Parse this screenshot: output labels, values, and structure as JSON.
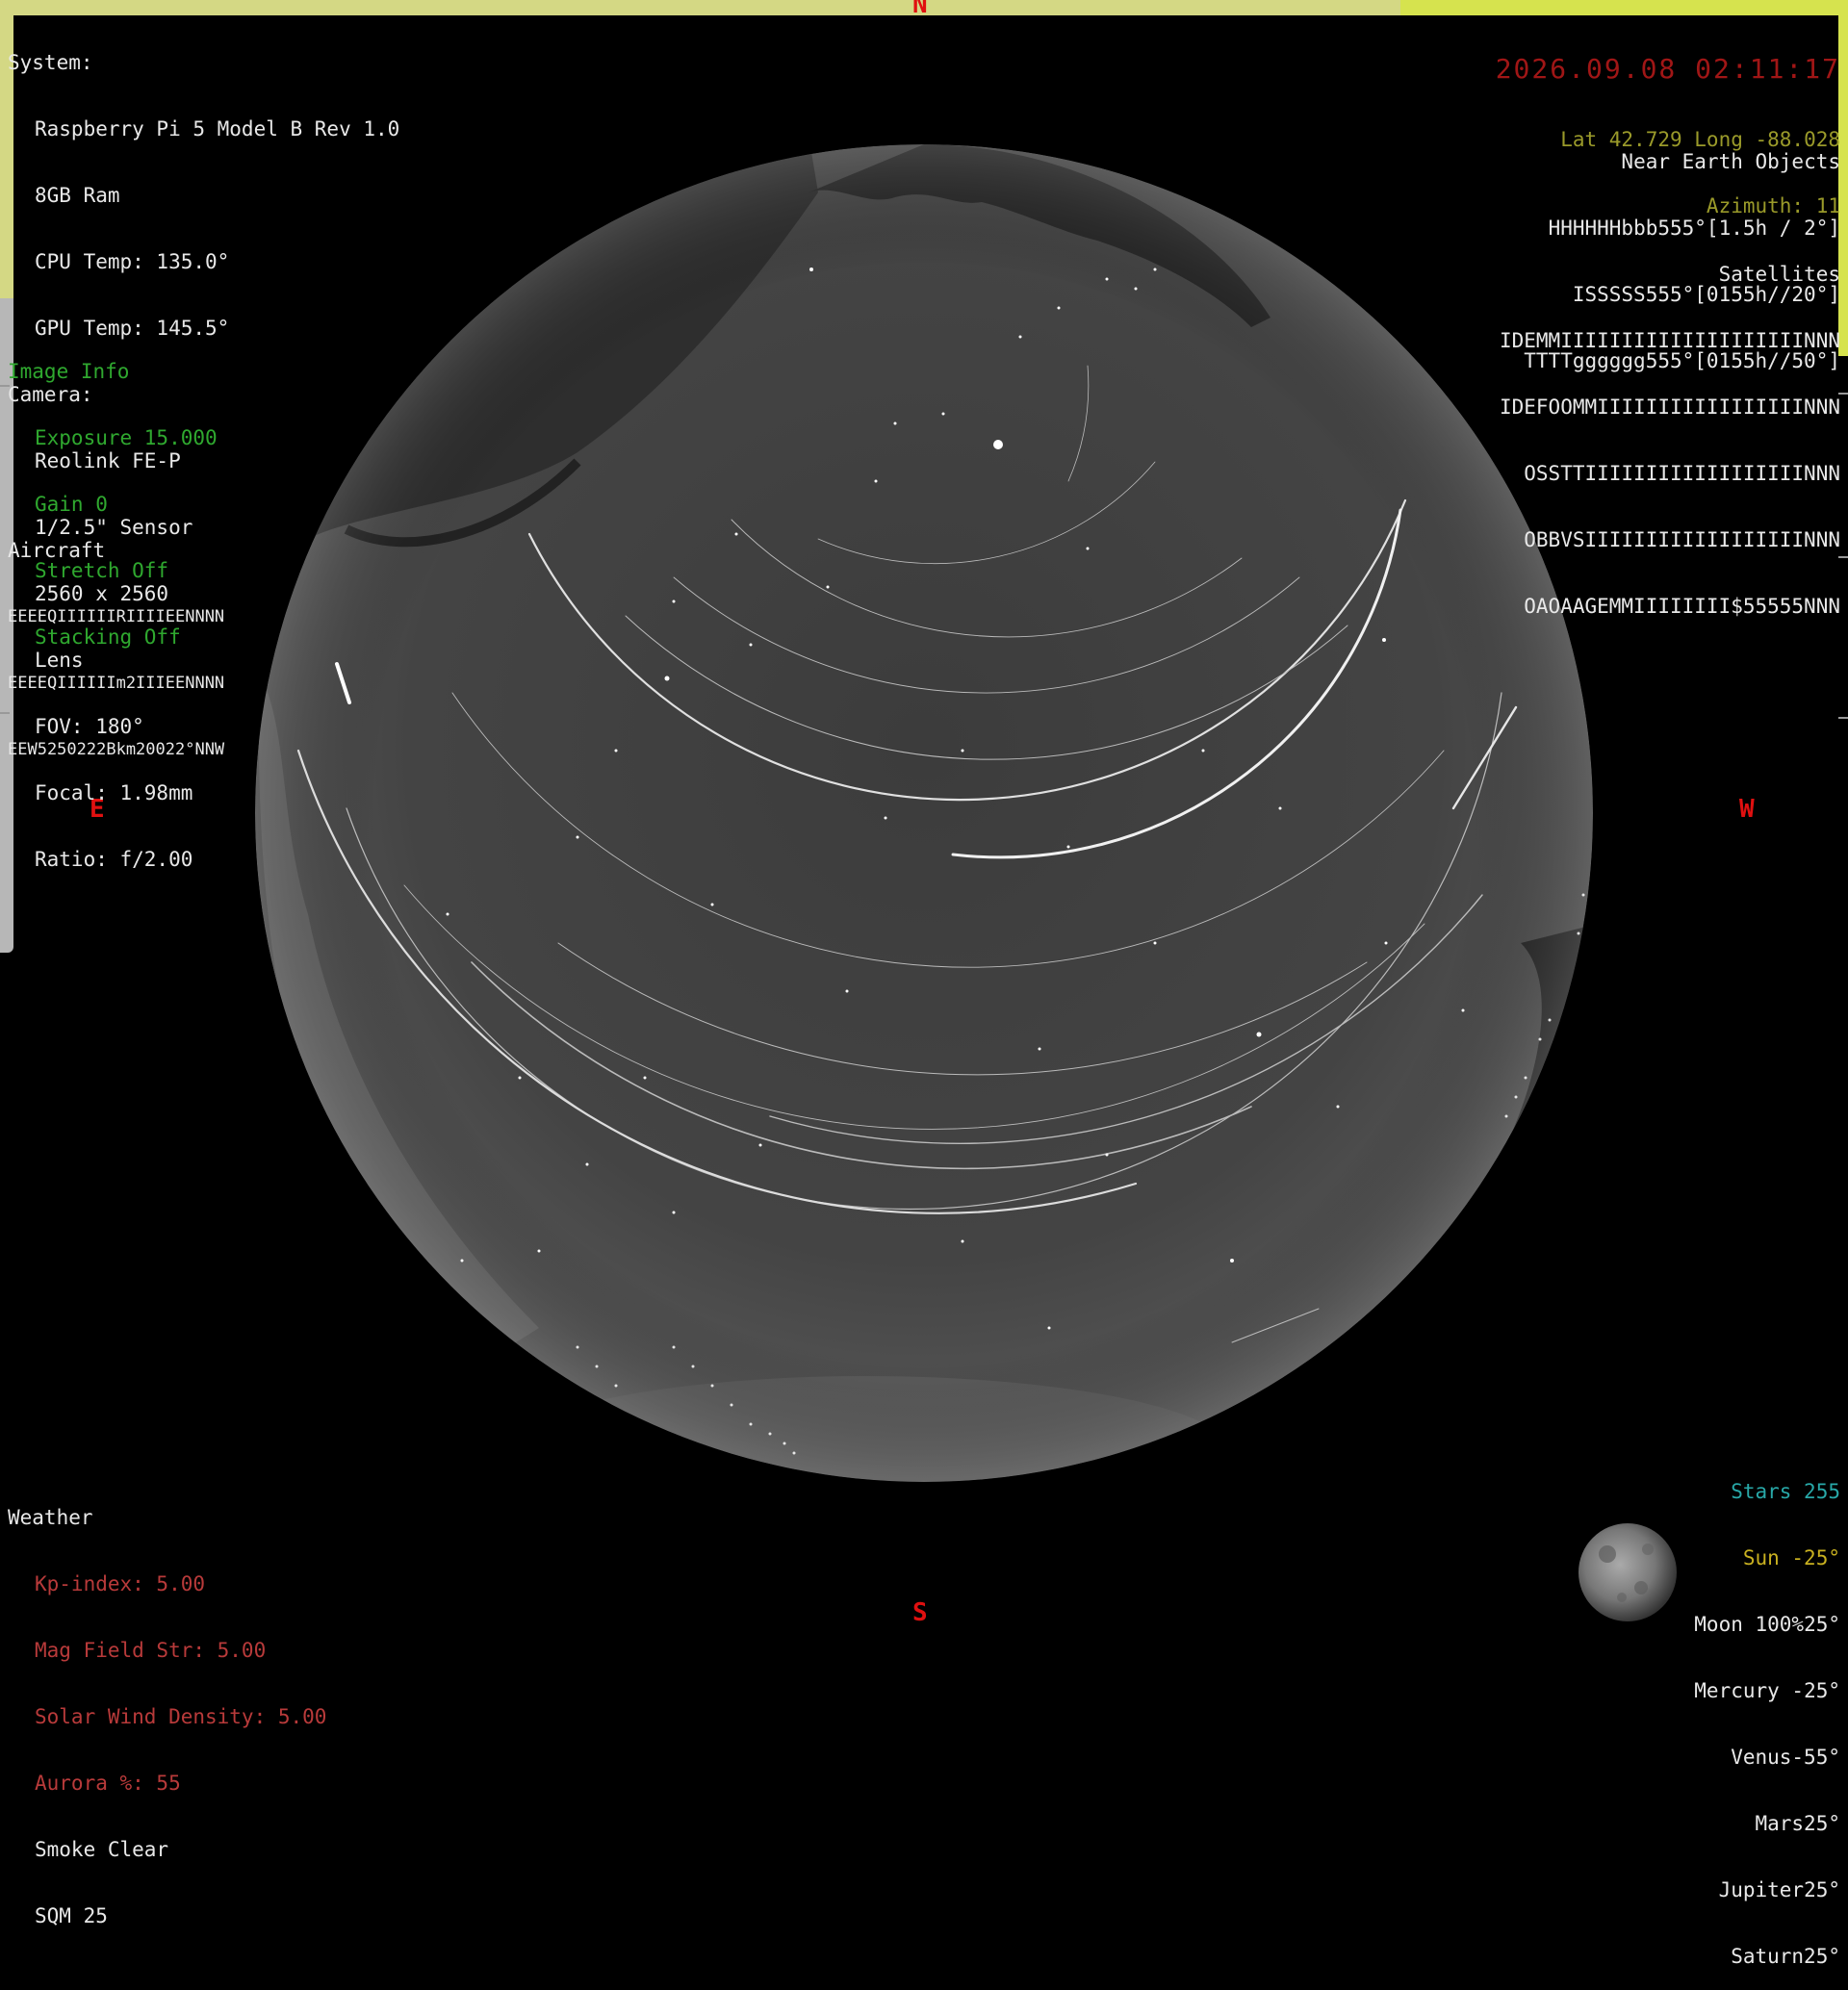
{
  "compass": {
    "n": "N",
    "s": "S",
    "e": "E",
    "w": "W"
  },
  "system": {
    "heading": "System:",
    "model": "Raspberry Pi 5 Model B Rev 1.0",
    "ram": "8GB Ram",
    "cpu_temp": "CPU Temp: 135.0°",
    "gpu_temp": "GPU Temp: 145.5°"
  },
  "camera": {
    "heading": "Camera:",
    "model": "Reolink FE-P",
    "sensor": "1/2.5\" Sensor",
    "resolution": "2560 x 2560",
    "lens_heading": "Lens",
    "fov": "FOV: 180°",
    "focal": "Focal: 1.98mm",
    "ratio": "Ratio: f/2.00"
  },
  "image_info": {
    "heading": "Image Info",
    "exposure": "Exposure 15.000",
    "gain": "Gain 0",
    "stretch": "Stretch Off",
    "stacking": "Stacking Off"
  },
  "aircraft": {
    "heading": "Aircraft",
    "rows": [
      "EEEEQIIIIIIRIIIIEENNNN",
      "EEEEQIIIIIIm2IIIEENNNN",
      "EEW5250222Bkm20022°NNW"
    ]
  },
  "header_right": {
    "datetime": "2026.09.08 02:11:17",
    "location": "Lat 42.729 Long -88.028",
    "azimuth": "Azimuth: 11"
  },
  "neo": {
    "heading": "Near Earth Objects",
    "rows": [
      "HHHHHHbbb555°[1.5h / 2°]",
      "ISSSSS555°[0155h//20°]",
      "TTTTgggggg555°[0155h//50°]"
    ]
  },
  "satellites": {
    "heading": "Satellites",
    "rows": [
      "IDEMMIIIIIIIIIIIIIIIIIIIINNN",
      "IDEFOOMMIIIIIIIIIIIIIIIIINNN",
      "OSSTTIIIIIIIIIIIIIIIIIINNN",
      "OBBVSIIIIIIIIIIIIIIIIIINNN",
      "OAOAAGEMMIIIIIIII$55555NNN"
    ]
  },
  "weather": {
    "heading": "Weather",
    "kp": "Kp-index: 5.00",
    "mag": "Mag Field Str: 5.00",
    "solar_wind": "Solar Wind Density: 5.00",
    "aurora": "Aurora %: 55",
    "smoke": "Smoke Clear",
    "sqm": "SQM 25"
  },
  "bodies": {
    "stars": "Stars 255",
    "sun": "Sun -25°",
    "moon": "Moon 100%25°",
    "mercury": "Mercury -25°",
    "venus": "Venus-55°",
    "mars": "Mars25°",
    "jupiter": "Jupiter25°",
    "saturn": "Saturn25°"
  },
  "colors": {
    "accent_yellow": "#d6e34e",
    "compass_red": "#e01010",
    "info_green": "#2fa82f",
    "weather_red": "#d44242",
    "stars_cyan": "#28a8a8",
    "sun_gold": "#c8b020"
  }
}
